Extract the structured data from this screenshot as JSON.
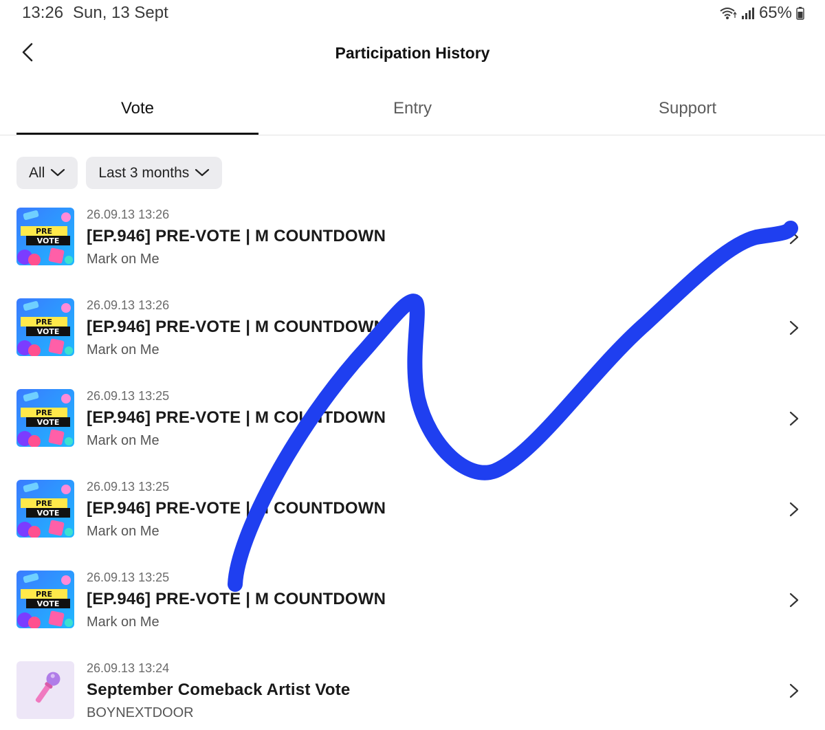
{
  "status_bar": {
    "time": "13:26",
    "date": "Sun, 13 Sept",
    "battery": "65%"
  },
  "header": {
    "title": "Participation History"
  },
  "tabs": [
    {
      "label": "Vote",
      "active": true
    },
    {
      "label": "Entry",
      "active": false
    },
    {
      "label": "Support",
      "active": false
    }
  ],
  "filters": {
    "category": "All",
    "period": "Last 3 months"
  },
  "items": [
    {
      "time": "26.09.13 13:26",
      "title": "[EP.946] PRE-VOTE | M COUNTDOWN",
      "subtitle": "Mark on Me",
      "thumb": "prevote-icon"
    },
    {
      "time": "26.09.13 13:26",
      "title": "[EP.946] PRE-VOTE | M COUNTDOWN",
      "subtitle": "Mark on Me",
      "thumb": "prevote-icon"
    },
    {
      "time": "26.09.13 13:25",
      "title": "[EP.946] PRE-VOTE | M COUNTDOWN",
      "subtitle": "Mark on Me",
      "thumb": "prevote-icon"
    },
    {
      "time": "26.09.13 13:25",
      "title": "[EP.946] PRE-VOTE | M COUNTDOWN",
      "subtitle": "Mark on Me",
      "thumb": "prevote-icon"
    },
    {
      "time": "26.09.13 13:25",
      "title": "[EP.946] PRE-VOTE | M COUNTDOWN",
      "subtitle": "Mark on Me",
      "thumb": "prevote-icon"
    },
    {
      "time": "26.09.13 13:24",
      "title": "September Comeback Artist Vote",
      "subtitle": "BOYNEXTDOOR",
      "thumb": "microphone-icon"
    }
  ],
  "thumb_text": {
    "line1": "PRE",
    "line2": "VOTE"
  },
  "colors": {
    "scribble": "#1f3ff0",
    "chip_bg": "#ececef",
    "mic_bg": "#ede6f7"
  }
}
